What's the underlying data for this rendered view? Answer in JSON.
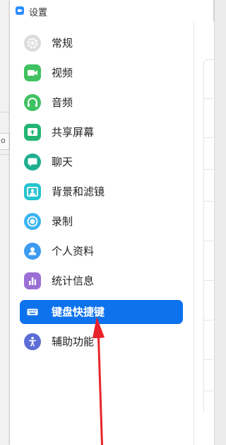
{
  "window": {
    "title": "设置"
  },
  "background": {
    "fragment_text": "o"
  },
  "menu": {
    "items": [
      {
        "label": "常规",
        "icon": "gear-icon",
        "color": "#d9d9d9"
      },
      {
        "label": "视频",
        "icon": "video-icon",
        "color": "#40c262"
      },
      {
        "label": "音频",
        "icon": "headphones-icon",
        "color": "#40c262"
      },
      {
        "label": "共享屏幕",
        "icon": "share-screen-icon",
        "color": "#22b573"
      },
      {
        "label": "聊天",
        "icon": "chat-icon",
        "color": "#1fae8f"
      },
      {
        "label": "背景和滤镜",
        "icon": "background-icon",
        "color": "#25c3d0"
      },
      {
        "label": "录制",
        "icon": "record-icon",
        "color": "#3ab4f2"
      },
      {
        "label": "个人资料",
        "icon": "profile-icon",
        "color": "#3b9bf0"
      },
      {
        "label": "统计信息",
        "icon": "statistics-icon",
        "color": "#9b6fd4"
      },
      {
        "label": "键盘快捷键",
        "icon": "keyboard-icon",
        "color": "#0e72ed",
        "active": true
      },
      {
        "label": "辅助功能",
        "icon": "accessibility-icon",
        "color": "#5b6cd6"
      }
    ]
  },
  "annotation": {
    "arrow_color": "#e8242a"
  }
}
